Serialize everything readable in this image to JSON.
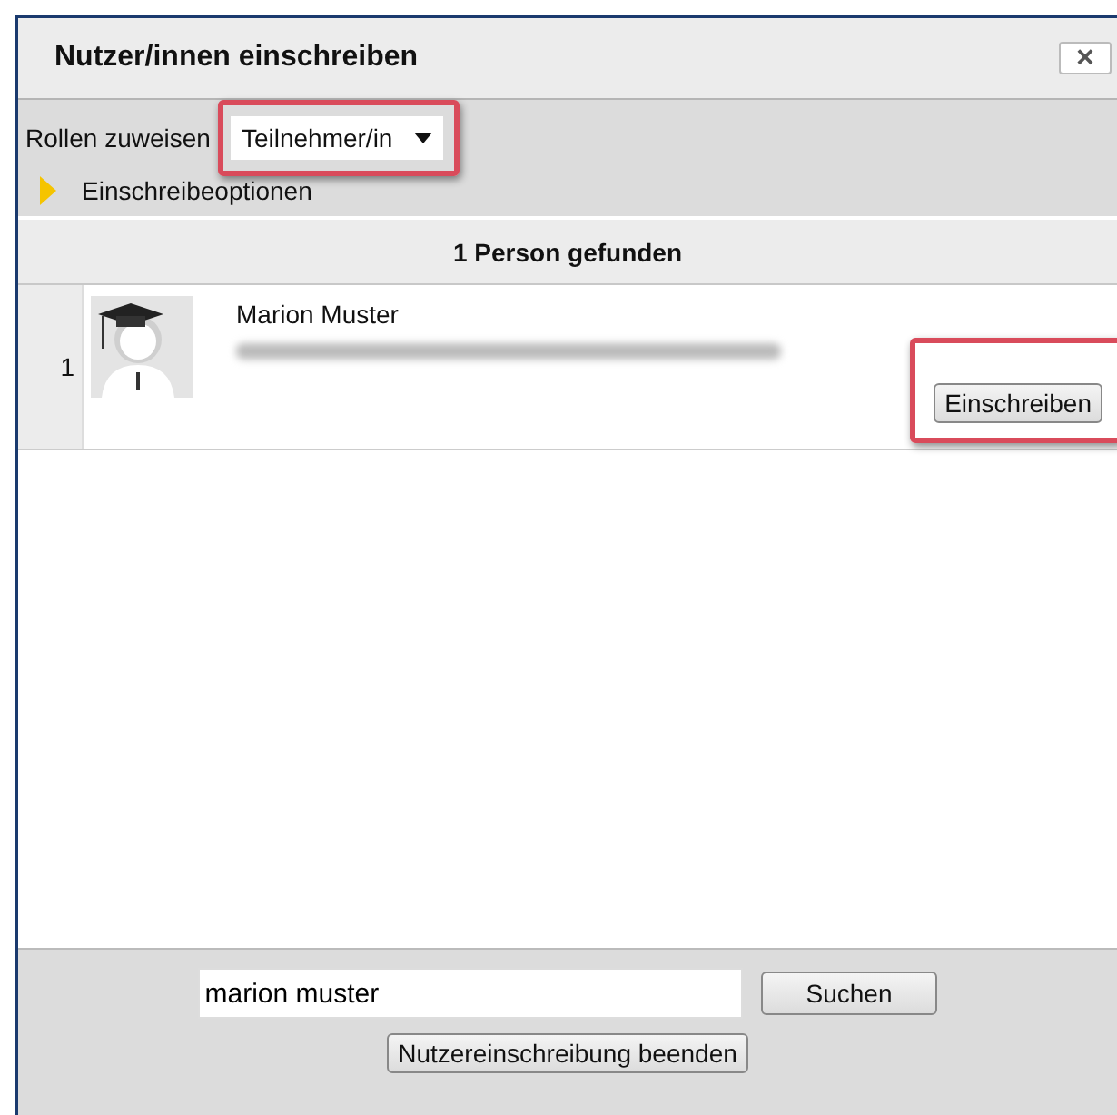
{
  "window": {
    "title": "Nutzer/innen einschreiben",
    "close": "×"
  },
  "roles": {
    "label": "Rollen zuweisen",
    "value": "Teilnehmer/in",
    "highlighted": true
  },
  "options": {
    "label": "Einschreibeoptionen",
    "expanded": false
  },
  "results": {
    "heading": "1 Person gefunden",
    "rows": [
      {
        "number": "1",
        "name": "Marion Muster",
        "button": "Einschreiben",
        "highlighted": true
      }
    ]
  },
  "search": {
    "value": "marion muster",
    "button": "Suchen"
  },
  "finish_button": "Nutzereinschreibung beenden"
}
